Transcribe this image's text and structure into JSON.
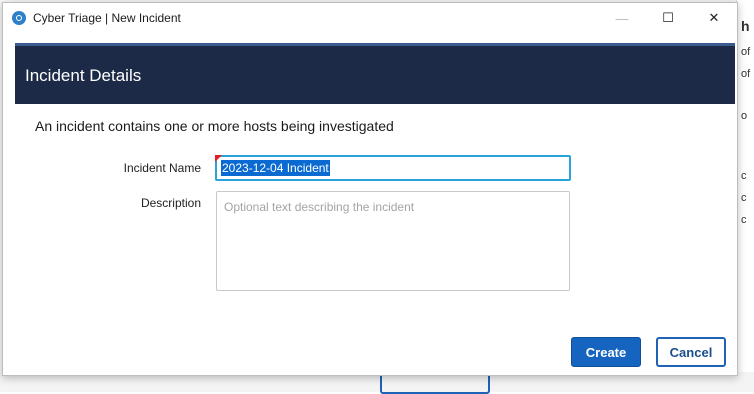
{
  "window": {
    "title": "Cyber Triage | New Incident",
    "controls": {
      "minimize": "—",
      "maximize": "☐",
      "close": "✕"
    }
  },
  "header": {
    "title": "Incident Details"
  },
  "intro_text": "An incident contains one or more hosts being investigated",
  "form": {
    "incident_name": {
      "label": "Incident Name",
      "value": "2023-12-04 Incident",
      "required": true
    },
    "description": {
      "label": "Description",
      "placeholder": "Optional text describing the incident",
      "value": ""
    }
  },
  "buttons": {
    "create": "Create",
    "cancel": "Cancel"
  },
  "background": {
    "right_edge_marks": [
      "h",
      "of",
      "of",
      "o",
      "c",
      "c",
      "c"
    ]
  },
  "colors": {
    "header_bg": "#1c2a48",
    "accent": "#1565c0",
    "focus_border": "#2aa3d8",
    "selection": "#0a6ad2",
    "required_marker": "#e02020"
  }
}
